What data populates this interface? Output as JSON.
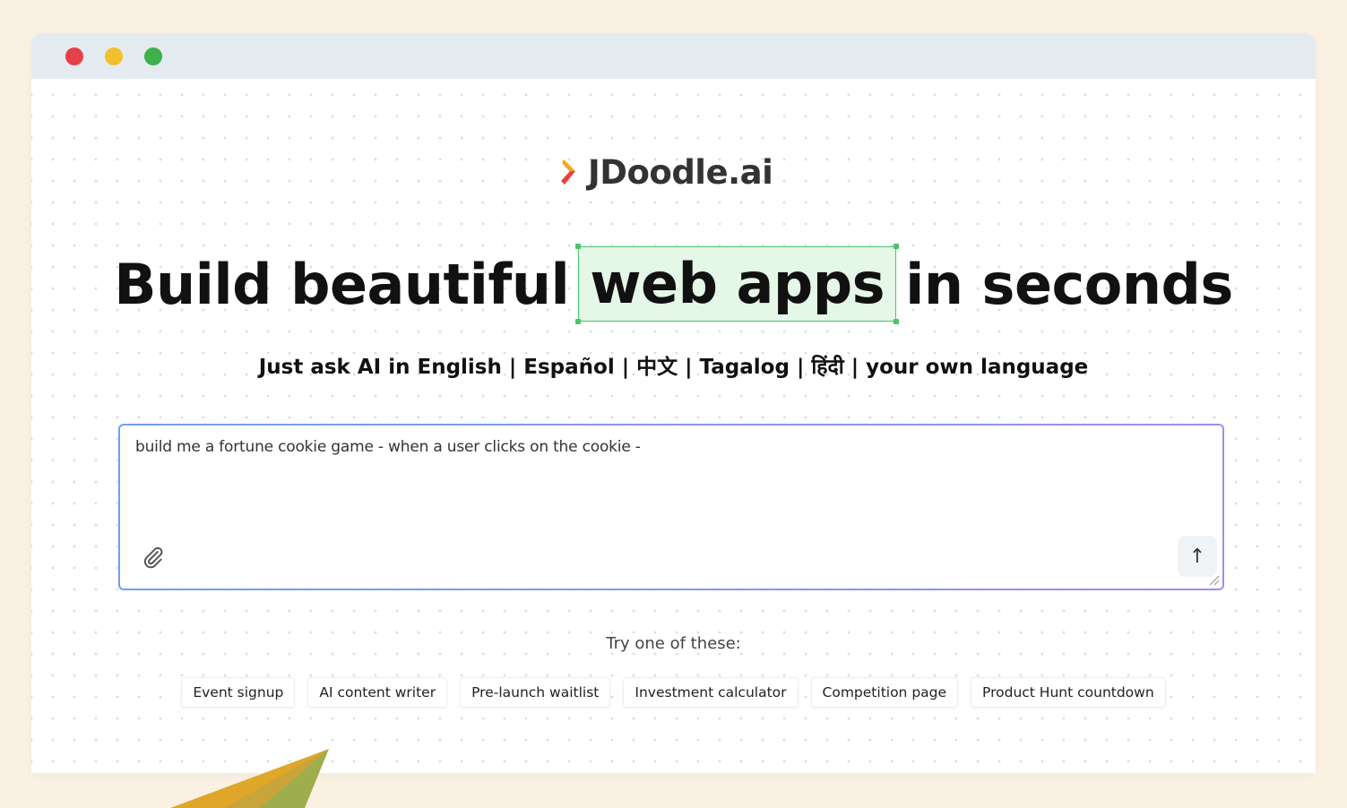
{
  "window": {
    "controls": [
      "close",
      "minimize",
      "maximize"
    ]
  },
  "logo": {
    "text": "JDoodle.ai",
    "mark_colors": [
      "#f5a623",
      "#e8413c"
    ]
  },
  "headline": {
    "before": "Build beautiful",
    "highlight": "web apps",
    "after": "in seconds"
  },
  "subhead": "Just ask AI in English | Español | 中文 | Tagalog | हिंदी | your own language",
  "prompt": {
    "value": "build me a fortune cookie game - when a user clicks on the cookie -",
    "attach_icon": "paperclip-icon",
    "send_label": "↑"
  },
  "suggestions": {
    "label": "Try one of these:",
    "items": [
      "Event signup",
      "AI content writer",
      "Pre-launch waitlist",
      "Investment calculator",
      "Competition page",
      "Product Hunt countdown"
    ]
  },
  "colors": {
    "page_background": "#faf1e3",
    "titlebar": "#e3ebf0",
    "highlight_fill": "#e5f7e7",
    "highlight_border": "#4cc46a",
    "prompt_border_start": "#6f9ff3",
    "prompt_border_end": "#9d8ef0"
  }
}
